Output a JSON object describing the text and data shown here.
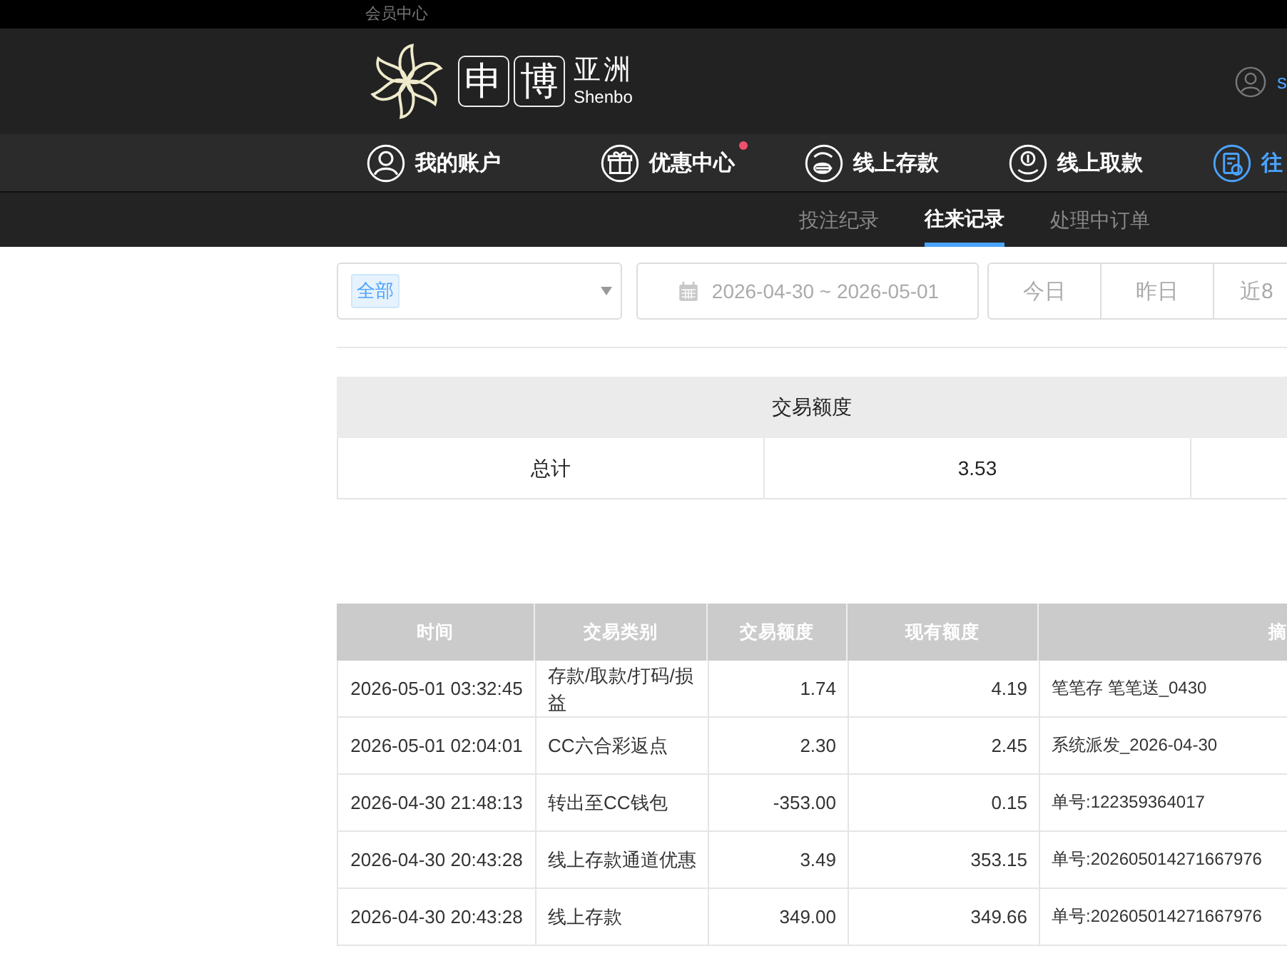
{
  "top_bar": {
    "title": "会员中心"
  },
  "header": {
    "logo": {
      "chars": [
        "申",
        "博"
      ],
      "name_cn": "亚洲",
      "name_en": "Shenbo"
    },
    "user": {
      "name": "s"
    }
  },
  "nav": [
    {
      "label": "我的账户",
      "kind": "account",
      "badge": false,
      "selected": false
    },
    {
      "label": "优惠中心",
      "kind": "promo",
      "badge": true,
      "selected": false
    },
    {
      "label": "线上存款",
      "kind": "deposit",
      "badge": false,
      "selected": false
    },
    {
      "label": "线上取款",
      "kind": "withdraw",
      "badge": false,
      "selected": false
    },
    {
      "label": "往",
      "kind": "records",
      "badge": false,
      "selected": true
    }
  ],
  "subnav": [
    {
      "label": "投注纪录",
      "selected": false
    },
    {
      "label": "往来记录",
      "selected": true
    },
    {
      "label": "处理中订单",
      "selected": false
    }
  ],
  "filter": {
    "type_select": {
      "value": "全部"
    },
    "date_range": {
      "value": "2026-04-30 ~ 2026-05-01"
    },
    "quick_ranges": [
      {
        "label": "今日",
        "selected": false
      },
      {
        "label": "昨日",
        "selected": false
      },
      {
        "label": "近8",
        "selected": false
      }
    ]
  },
  "summary": {
    "header": "交易额度",
    "row": {
      "label": "总计",
      "value": "3.53"
    }
  },
  "table": {
    "columns": [
      "时间",
      "交易类别",
      "交易额度",
      "现有额度",
      "摘"
    ],
    "rows": [
      [
        "2026-05-01 03:32:45",
        "存款/取款/打码/损益",
        "1.74",
        "4.19",
        "笔笔存 笔笔送_0430"
      ],
      [
        "2026-05-01 02:04:01",
        "CC六合彩返点",
        "2.30",
        "2.45",
        "系统派发_2026-04-30"
      ],
      [
        "2026-04-30 21:48:13",
        "转出至CC钱包",
        "-353.00",
        "0.15",
        "单号:122359364017"
      ],
      [
        "2026-04-30 20:43:28",
        "线上存款通道优惠",
        "3.49",
        "353.15",
        "单号:202605014271667976"
      ],
      [
        "2026-04-30 20:43:28",
        "线上存款",
        "349.00",
        "349.66",
        "单号:202605014271667976"
      ]
    ]
  }
}
